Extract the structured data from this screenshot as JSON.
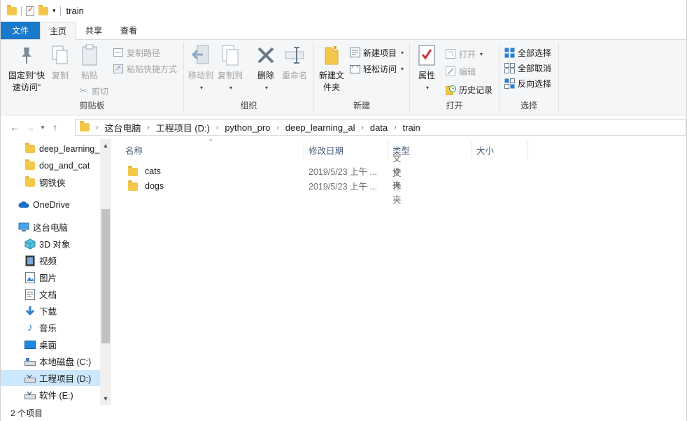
{
  "window": {
    "title": "train"
  },
  "tabs": {
    "file": "文件",
    "home": "主页",
    "share": "共享",
    "view": "查看"
  },
  "ribbon": {
    "clipboard": {
      "label": "剪贴板",
      "pin": "固定到\"快速访问\"",
      "copy": "复制",
      "paste": "粘贴",
      "copy_path": "复制路径",
      "paste_shortcut": "粘贴快捷方式",
      "cut": "剪切"
    },
    "organize": {
      "label": "组织",
      "move_to": "移动到",
      "copy_to": "复制到",
      "delete": "删除",
      "rename": "重命名"
    },
    "new": {
      "label": "新建",
      "new_folder": "新建文件夹",
      "new_item": "新建项目",
      "easy_access": "轻松访问"
    },
    "open": {
      "label": "打开",
      "properties": "属性",
      "open": "打开",
      "edit": "编辑",
      "history": "历史记录"
    },
    "select": {
      "label": "选择",
      "select_all": "全部选择",
      "select_none": "全部取消",
      "invert": "反向选择"
    }
  },
  "address": {
    "crumbs": [
      "这台电脑",
      "工程项目 (D:)",
      "python_pro",
      "deep_learning_al",
      "data",
      "train"
    ]
  },
  "nav": {
    "items": [
      {
        "label": "deep_learning_",
        "icon": "folder-icon"
      },
      {
        "label": "dog_and_cat",
        "icon": "folder-icon"
      },
      {
        "label": "钢铁侠",
        "icon": "folder-icon"
      },
      {
        "label": "OneDrive",
        "icon": "cloud-icon"
      },
      {
        "label": "这台电脑",
        "icon": "computer-icon"
      },
      {
        "label": "3D 对象",
        "icon": "cube-icon"
      },
      {
        "label": "视频",
        "icon": "video-icon"
      },
      {
        "label": "图片",
        "icon": "picture-icon"
      },
      {
        "label": "文档",
        "icon": "document-icon"
      },
      {
        "label": "下载",
        "icon": "download-icon"
      },
      {
        "label": "音乐",
        "icon": "music-icon"
      },
      {
        "label": "桌面",
        "icon": "desktop-icon"
      },
      {
        "label": "本地磁盘 (C:)",
        "icon": "drive-icon"
      },
      {
        "label": "工程项目 (D:)",
        "icon": "drive-icon"
      },
      {
        "label": "软件 (E:)",
        "icon": "drive-icon"
      }
    ]
  },
  "columns": {
    "name": "名称",
    "modified": "修改日期",
    "type": "类型",
    "size": "大小"
  },
  "files": [
    {
      "name": "cats",
      "modified": "2019/5/23 上午 ...",
      "type": "文件夹"
    },
    {
      "name": "dogs",
      "modified": "2019/5/23 上午 ...",
      "type": "文件夹"
    }
  ],
  "status": {
    "count": "2 个项目"
  },
  "colors": {
    "accent": "#1979ca",
    "selection": "#cce8ff",
    "folder": "#f3c84a"
  }
}
